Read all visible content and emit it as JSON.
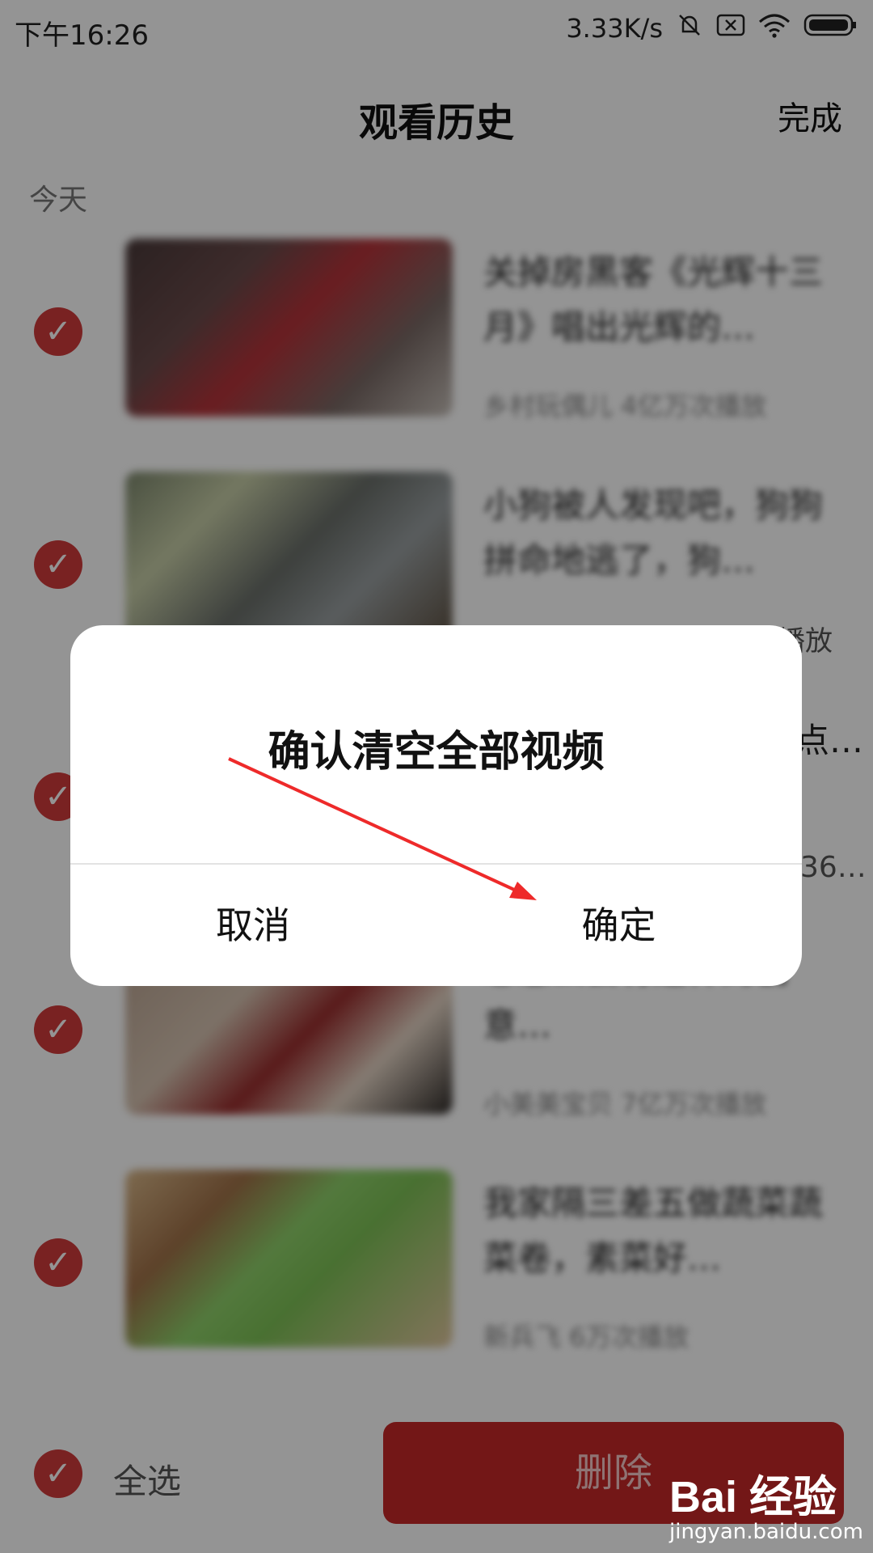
{
  "status_bar": {
    "time": "下午16:26",
    "speed": "3.33K/s",
    "icons": [
      "bell-off-icon",
      "close-box-icon",
      "wifi-icon",
      "battery-icon"
    ]
  },
  "header": {
    "title": "观看历史",
    "done_label": "完成"
  },
  "section_label": "今天",
  "list": {
    "items": [
      {
        "title": "关掉房黑客《光辉十三月》唱出光辉的…",
        "meta": "乡村玩偶儿 4亿万次播放"
      },
      {
        "title": "小狗被人发现吧，狗狗拼命地逃了，狗…",
        "meta": "播放"
      },
      {
        "title": "点…",
        "meta": "36…"
      },
      {
        "title": "忘怎么会有这样的创意…",
        "meta": "小美美宝贝 7亿万次播放"
      },
      {
        "title": "我家隔三差五做蔬菜蔬菜卷，素菜好…",
        "meta": "新兵飞 6万次播放"
      }
    ],
    "check_icon": "check-icon"
  },
  "bottom_bar": {
    "select_all_label": "全选",
    "delete_label": "删除"
  },
  "dialog": {
    "title": "确认清空全部视频",
    "cancel_label": "取消",
    "confirm_label": "确定"
  },
  "watermark": {
    "logo": "Bai 经验",
    "site": "jingyan.baidu.com"
  },
  "colors": {
    "accent_red": "#d13b3b",
    "delete_red": "#c62828",
    "overlay": "rgba(0,0,0,0.42)",
    "arrow_red": "#ee2a2a"
  }
}
